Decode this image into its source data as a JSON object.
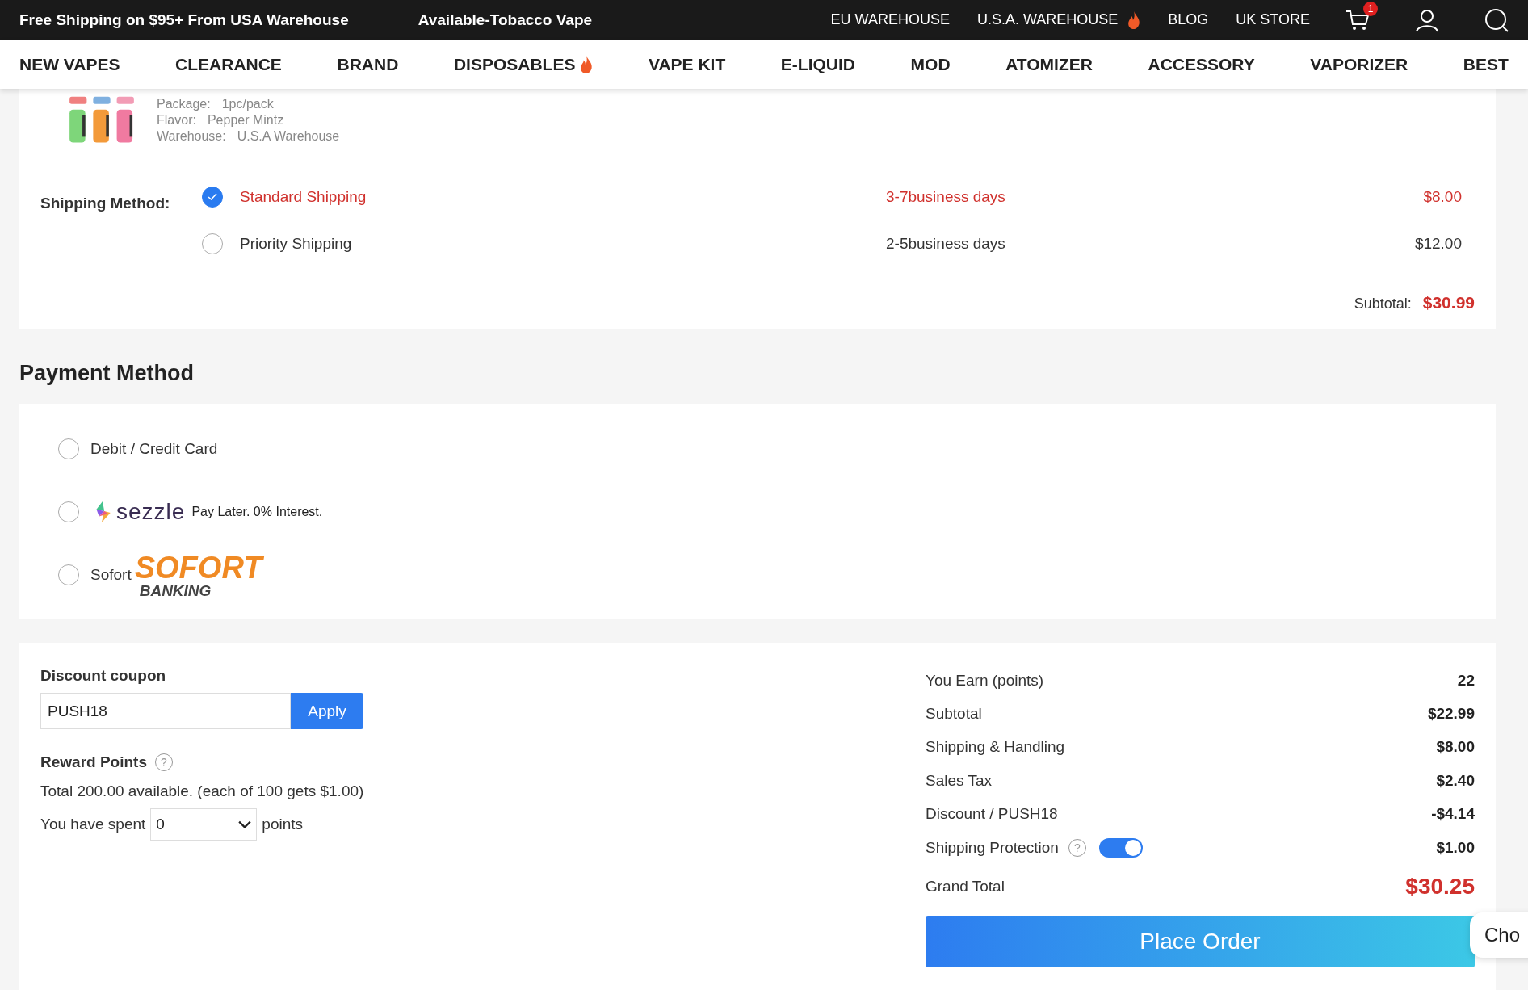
{
  "top_bar": {
    "promos": [
      "Free Shipping on $95+ From USA Warehouse",
      "Available-Tobacco Vape"
    ],
    "links": [
      {
        "label": "EU WAREHOUSE",
        "hot": false
      },
      {
        "label": "U.S.A. WAREHOUSE",
        "hot": true
      },
      {
        "label": "BLOG",
        "hot": false
      },
      {
        "label": "UK STORE",
        "hot": false
      }
    ],
    "cart_count": "1"
  },
  "nav": [
    {
      "label": "NEW VAPES",
      "hot": false
    },
    {
      "label": "CLEARANCE",
      "hot": false
    },
    {
      "label": "BRAND",
      "hot": false
    },
    {
      "label": "DISPOSABLES",
      "hot": true
    },
    {
      "label": "VAPE KIT",
      "hot": false
    },
    {
      "label": "E-LIQUID",
      "hot": false
    },
    {
      "label": "MOD",
      "hot": false
    },
    {
      "label": "ATOMIZER",
      "hot": false
    },
    {
      "label": "ACCESSORY",
      "hot": false
    },
    {
      "label": "VAPORIZER",
      "hot": false
    },
    {
      "label": "BEST",
      "hot": false
    }
  ],
  "product": {
    "details": [
      {
        "label": "Package:",
        "value": "1pc/pack"
      },
      {
        "label": "Flavor:",
        "value": "Pepper Mintz"
      },
      {
        "label": "Warehouse:",
        "value": "U.S.A Warehouse"
      }
    ]
  },
  "shipping": {
    "label": "Shipping Method:",
    "options": [
      {
        "name": "Standard Shipping",
        "time": "3-7business days",
        "price": "$8.00",
        "selected": true
      },
      {
        "name": "Priority Shipping",
        "time": "2-5business days",
        "price": "$12.00",
        "selected": false
      }
    ],
    "subtotal_label": "Subtotal:",
    "subtotal": "$30.99"
  },
  "payment": {
    "title": "Payment Method",
    "options": [
      {
        "kind": "text",
        "label": "Debit / Credit Card",
        "selected": false
      },
      {
        "kind": "sezzle",
        "logo": "sezzle",
        "label": "Pay Later. 0% Interest.",
        "selected": false
      },
      {
        "kind": "sofort",
        "label": "Sofort",
        "logo": "SOFORT",
        "logo_sub": "BANKING",
        "selected": false
      }
    ]
  },
  "coupon": {
    "label": "Discount coupon",
    "value": "PUSH18",
    "button": "Apply"
  },
  "rewards": {
    "label": "Reward Points",
    "info": "Total 200.00 available. (each of 100 gets $1.00)",
    "spent_prefix": "You have spent",
    "spent_value": "0",
    "spent_suffix": "points",
    "help": "?"
  },
  "summary": {
    "rows": [
      {
        "kind": "plain",
        "label": "You Earn (points)",
        "value": "22"
      },
      {
        "kind": "plain",
        "label": "Subtotal",
        "value": "$22.99"
      },
      {
        "kind": "plain",
        "label": "Shipping & Handling",
        "value": "$8.00"
      },
      {
        "kind": "plain",
        "label": "Sales Tax",
        "value": "$2.40"
      },
      {
        "kind": "plain",
        "label": "Discount / PUSH18",
        "value": "-$4.14"
      },
      {
        "kind": "toggle",
        "label": "Shipping Protection",
        "value": "$1.00",
        "on": true,
        "help": "?"
      }
    ],
    "total_label": "Grand Total",
    "total": "$30.25",
    "button": "Place Order"
  },
  "chat": {
    "label": "Cho"
  }
}
